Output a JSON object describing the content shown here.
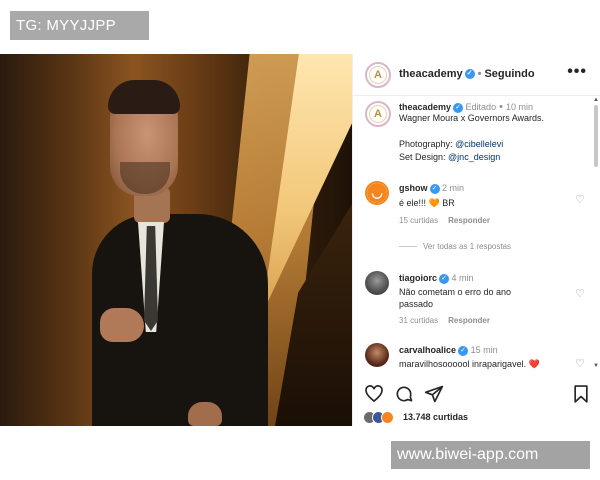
{
  "watermarks": {
    "top": "TG: MYYJJPP",
    "bottom": "www.biwei-app.com"
  },
  "header": {
    "username": "theacademy",
    "verified": true,
    "follow_status": "Seguindo",
    "more_icon": "more-dots-icon"
  },
  "caption": {
    "username": "theacademy",
    "edited": "Editado",
    "time": "10 min",
    "text": "Wagner Moura x Governors Awards.",
    "photography_label": "Photography:",
    "photography_handle": "@cibellelevi",
    "set_design_label": "Set Design:",
    "set_design_handle": "@jnc_design"
  },
  "comments": [
    {
      "username": "gshow",
      "verified": true,
      "time": "2 min",
      "text": "é ele!!! 🧡 BR",
      "likes": "15 curtidas",
      "reply": "Responder"
    },
    {
      "username": "tiagoiorc",
      "verified": true,
      "time": "4 min",
      "text_line1": "Não cometam o erro do ano",
      "text_line2": "passado",
      "likes": "31 curtidas",
      "reply": "Responder"
    },
    {
      "username": "carvalhoalice",
      "verified": true,
      "time": "15 min",
      "text": "maravilhosoooool inraparigavel. ❤️"
    }
  ],
  "view_replies": "Ver todas as 1 respostas",
  "footer": {
    "likes": "13.748 curtidas"
  },
  "colors": {
    "verified": "#3897f0",
    "link": "#00376b",
    "muted": "#8e8e8e",
    "heart_red": "#ed4956",
    "orange": "#f5851f"
  }
}
